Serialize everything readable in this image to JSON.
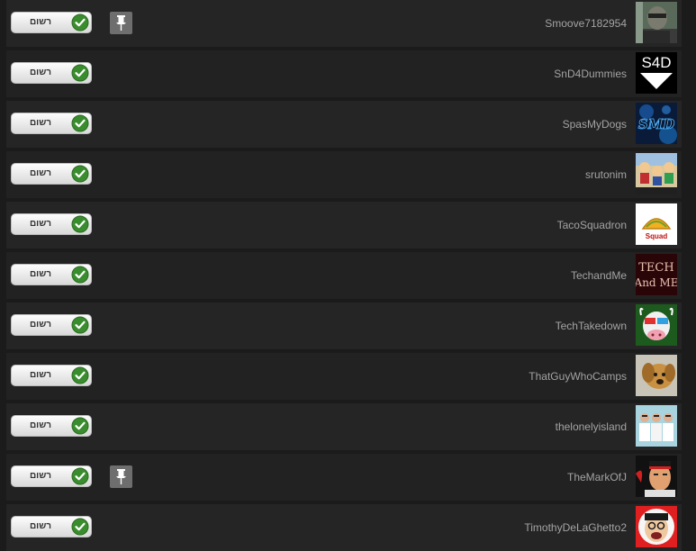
{
  "subscribe_label": "רשום",
  "channels": [
    {
      "username": "Smoove7182954",
      "pinned": true
    },
    {
      "username": "SnD4Dummies",
      "pinned": false,
      "avatar_text": "S4D"
    },
    {
      "username": "SpasMyDogs",
      "pinned": false,
      "avatar_text": "SMD"
    },
    {
      "username": "srutonim",
      "pinned": false
    },
    {
      "username": "TacoSquadron",
      "pinned": false,
      "avatar_text": "Squad"
    },
    {
      "username": "TechandMe",
      "pinned": false,
      "avatar_text": "TECH",
      "avatar_text2": "And ME"
    },
    {
      "username": "TechTakedown",
      "pinned": false
    },
    {
      "username": "ThatGuyWhoCamps",
      "pinned": false
    },
    {
      "username": "thelonelyisland",
      "pinned": false
    },
    {
      "username": "TheMarkOfJ",
      "pinned": true
    },
    {
      "username": "TimothyDeLaGhetto2",
      "pinned": false
    }
  ],
  "icons": {
    "subscribed": "check-circle-icon",
    "pin": "pushpin-icon"
  },
  "colors": {
    "check_green": "#3a8d2e",
    "username_text": "#a3a3a3",
    "row_dark": "#252525",
    "row_darker": "#222222"
  }
}
